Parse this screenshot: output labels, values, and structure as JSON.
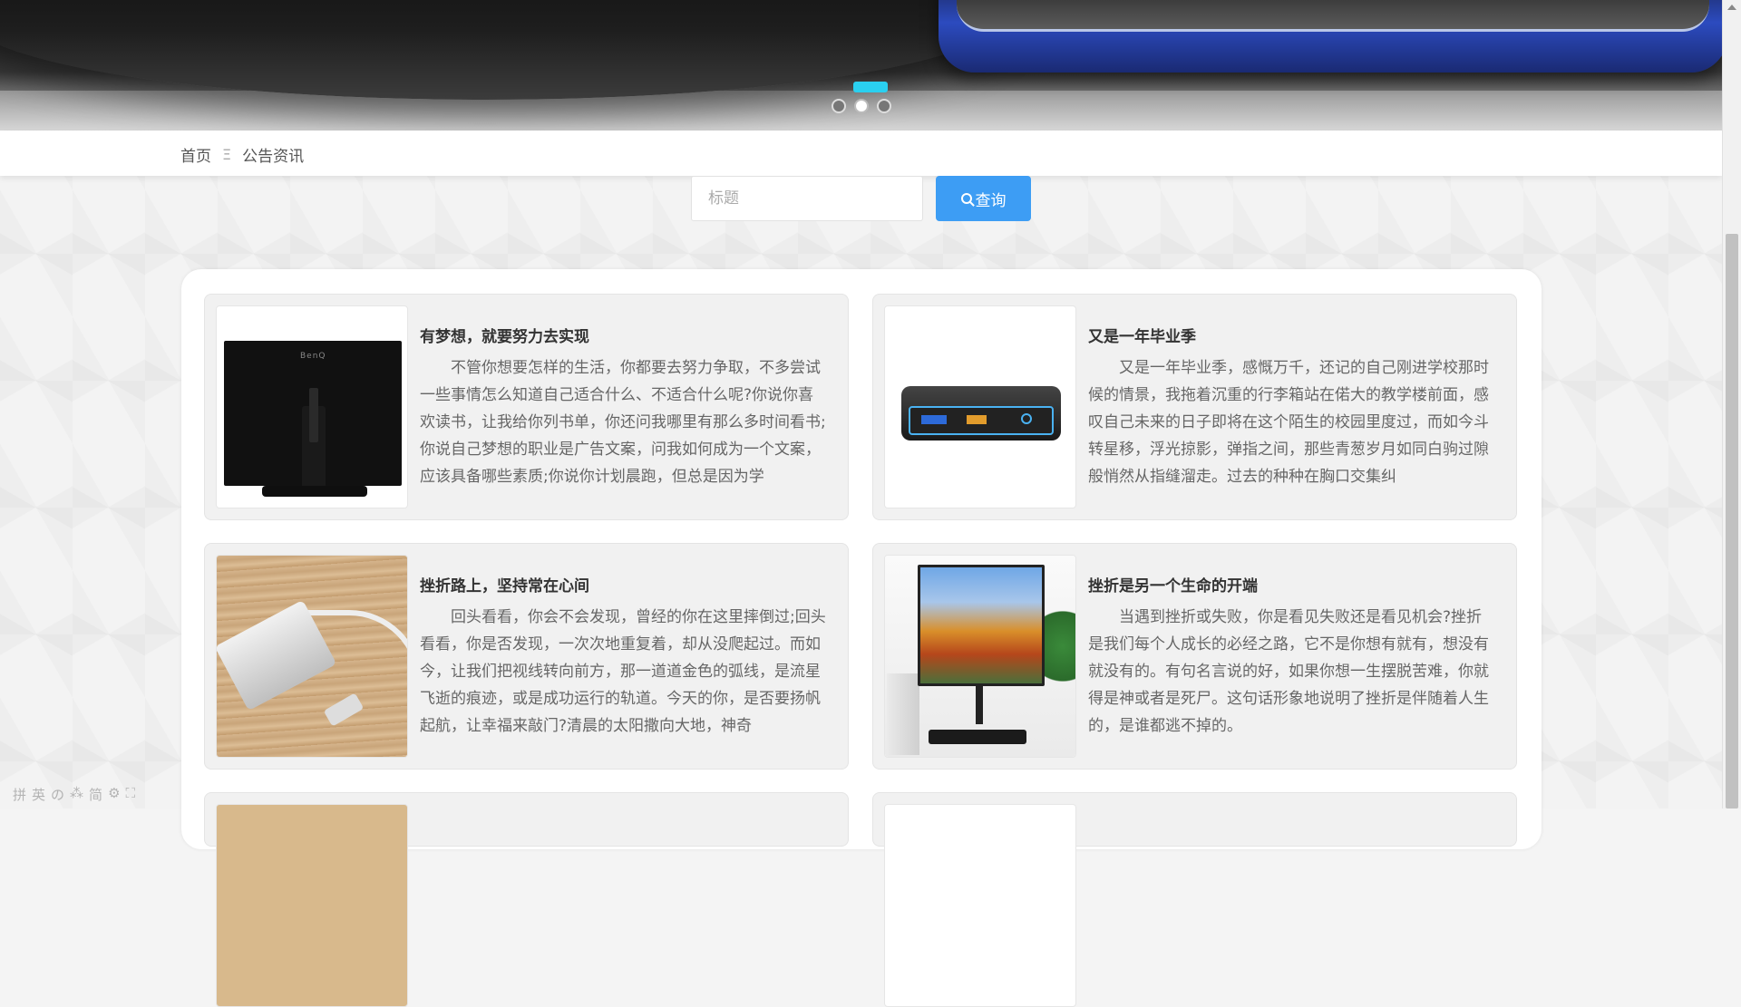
{
  "carousel": {
    "dots": [
      {
        "active": false
      },
      {
        "active": true
      },
      {
        "active": false
      }
    ]
  },
  "breadcrumb": {
    "home": "首页",
    "separator": "Ξ",
    "current": "公告资讯"
  },
  "search": {
    "placeholder": "标题",
    "button_label": "查询"
  },
  "articles": [
    {
      "title": "有梦想，就要努力去实现",
      "excerpt": "不管你想要怎样的生活，你都要去努力争取，不多尝试一些事情怎么知道自己适合什么、不适合什么呢?你说你喜欢读书，让我给你列书单，你还问我哪里有那么多时间看书;你说自己梦想的职业是广告文案，问我如何成为一个文案，应该具备哪些素质;你说你计划晨跑，但总是因为学",
      "image": "monitor-back-image",
      "brand": "BenQ"
    },
    {
      "title": "又是一年毕业季",
      "excerpt": "又是一年毕业季，感慨万千，还记的自己刚进学校那时候的情景，我拖着沉重的行李箱站在偌大的教学楼前面，感叹自己未来的日子即将在这个陌生的校园里度过，而如今斗转星移，浮光掠影，弹指之间，那些青葱岁月如同白驹过隙般悄然从指缝溜走。过去的种种在胸口交集纠",
      "image": "mini-pc-image"
    },
    {
      "title": "挫折路上，坚持常在心间",
      "excerpt": "回头看看，你会不会发现，曾经的你在这里摔倒过;回头看看，你是否发现，一次次地重复着，却从没爬起过。而如今，让我们把视线转向前方，那一道道金色的弧线，是流星飞逝的痕迹，或是成功运行的轨道。今天的你，是否要扬帆起航，让幸福来敲门?清晨的太阳撒向大地，神奇",
      "image": "usb-hub-image"
    },
    {
      "title": "挫折是另一个生命的开端",
      "excerpt": "当遇到挫折或失败，你是看见失败还是看见机会?挫折是我们每个人成长的必经之路，它不是你想有就有，想没有就没有的。有句名言说的好，如果你想一生摆脱苦难，你就得是神或者是死尸。这句话形象地说明了挫折是伴随着人生的，是谁都逃不掉的。",
      "image": "desktop-monitor-image"
    }
  ],
  "ime_toolbar": [
    "拼",
    "英",
    "の",
    "⁂",
    "简",
    "⚙",
    "⛶"
  ]
}
